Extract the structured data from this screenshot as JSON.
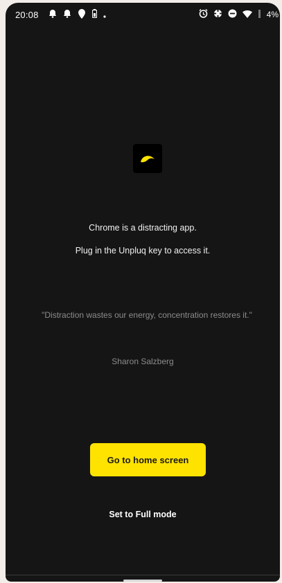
{
  "status_bar": {
    "time": "20:08",
    "battery_text": "4%",
    "left_icons": [
      "notification-bell-icon",
      "notification-bell-icon",
      "maps-pin-icon",
      "battery-saver-icon",
      "dot-icon"
    ],
    "right_icons": [
      "alarm-icon",
      "data-saver-icon",
      "do-not-disturb-icon",
      "wifi-icon",
      "signal-icon"
    ]
  },
  "app": {
    "logo_icon": "unpluq-logo-icon",
    "accent_color": "#ffe300"
  },
  "block_screen": {
    "message_line_1": "Chrome is a distracting app.",
    "message_line_2": "Plug in the Unpluq key to access it.",
    "quote": "\"Distraction wastes our energy, concentration restores it.\"",
    "author": "Sharon Salzberg",
    "primary_button_label": "Go to home screen",
    "secondary_link_label": "Set to Full mode"
  }
}
